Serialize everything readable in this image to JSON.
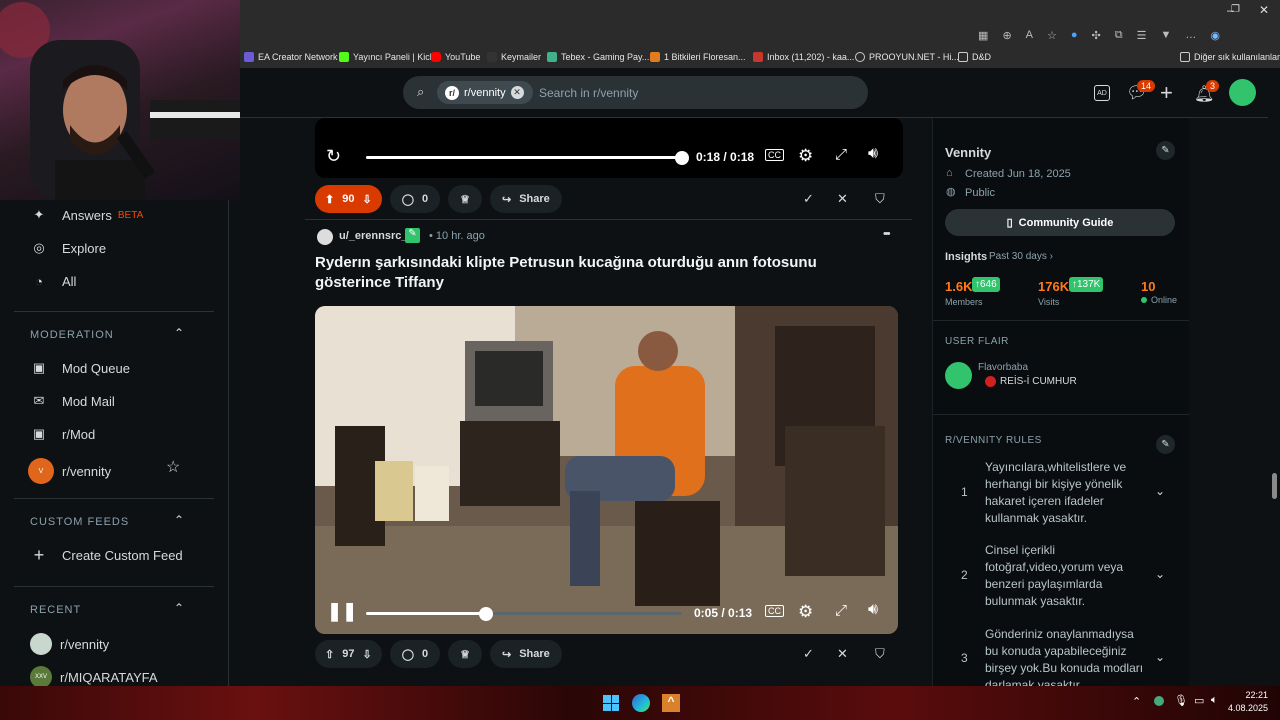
{
  "browser": {
    "bookmarks": [
      "EA Creator Network",
      "Yayıncı Paneli | Kick",
      "YouTube",
      "Keymailer",
      "Tebex - Gaming Pay...",
      "1 Bitkileri Floresan...",
      "Inbox (11,202) - kaa...",
      "PROOYUN.NET - Hi...",
      "D&D"
    ],
    "other_bookmarks": "Diğer sık kullanılanlar",
    "window_controls": [
      "–",
      "❐",
      "✕"
    ]
  },
  "header": {
    "community_chip": "r/vennity",
    "search_placeholder": "Search in r/vennity",
    "chat_badge": "14",
    "notif_badge": "3"
  },
  "sidebar": {
    "top_items": [
      {
        "label": "Answers",
        "badge": "BETA"
      },
      {
        "label": "Explore"
      },
      {
        "label": "All"
      }
    ],
    "moderation_title": "MODERATION",
    "moderation_items": [
      "Mod Queue",
      "Mod Mail",
      "r/Mod",
      "r/vennity"
    ],
    "custom_feeds_title": "CUSTOM FEEDS",
    "create_feed": "Create Custom Feed",
    "recent_title": "RECENT",
    "recent_items": [
      "r/vennity",
      "r/MIQARATAYFA"
    ]
  },
  "post1": {
    "time": "0:18 / 0:18",
    "progress": 1.0,
    "votes": "90",
    "comments": "0",
    "share": "Share"
  },
  "post2": {
    "author": "u/_erennsrc_",
    "age": "• 10 hr. ago",
    "title": "Ryderın şarkısındaki klipte Petrusun kucağına oturduğu anın fotosunu gösterince Tiffany",
    "time": "0:05 / 0:13",
    "progress": 0.38,
    "votes": "97",
    "comments": "0",
    "share": "Share",
    "more": "•••"
  },
  "community": {
    "name": "Vennity",
    "created": "Created Jun 18, 2025",
    "visibility": "Public",
    "guide_button": "Community Guide",
    "insights_label": "Insights",
    "insights_period": "Past 30 days ›",
    "members_value": "1.6K",
    "members_delta": "↑646",
    "members_label": "Members",
    "visits_value": "176K",
    "visits_delta": "↑137K",
    "visits_label": "Visits",
    "online_value": "10",
    "online_label": "Online",
    "user_flair_title": "USER FLAIR",
    "flair_user": "Flavorbaba",
    "flair_text": "REİS-İ CUMHUR",
    "rules_title": "R/VENNITY RULES",
    "rules": [
      {
        "num": "1",
        "text": "Yayıncılara,whitelistlere ve herhangi bir kişiye yönelik hakaret içeren ifadeler kullanmak yasaktır."
      },
      {
        "num": "2",
        "text": "Cinsel içerikli fotoğraf,video,yorum veya benzeri paylaşımlarda bulunmak yasaktır."
      },
      {
        "num": "3",
        "text": "Gönderiniz onaylanmadıysa bu konuda yapabileceğiniz birşey yok.Bu konuda modları darlamak yasaktır."
      }
    ]
  },
  "taskbar": {
    "time": "22:21",
    "date": "4.08.2025"
  },
  "colors": {
    "upvote": "#d93a00",
    "accent_green": "#31c46c",
    "bg": "#0e1113"
  }
}
